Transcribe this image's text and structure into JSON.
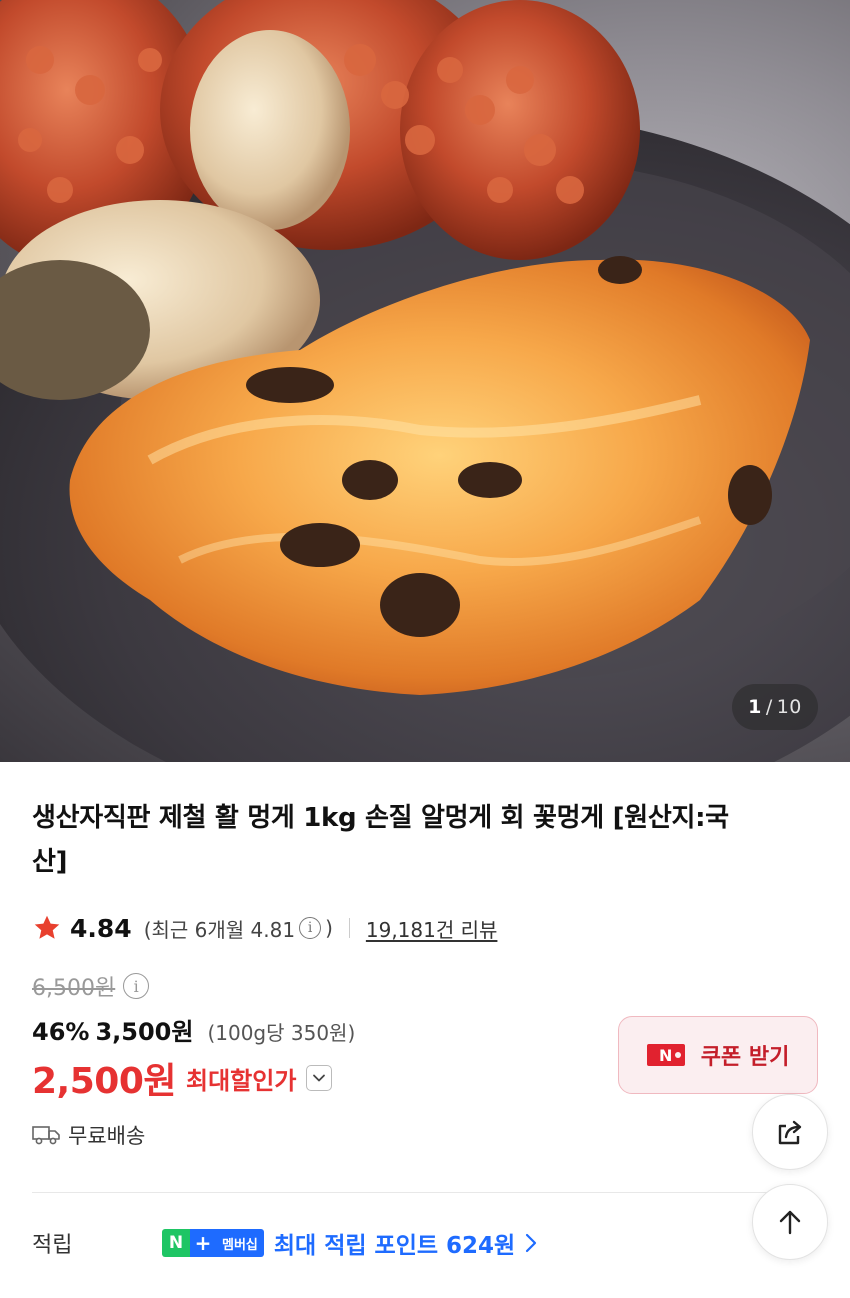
{
  "image": {
    "counter_current": "1",
    "counter_separator": "/",
    "counter_total": "10",
    "description_icon": "product-photo"
  },
  "product": {
    "title": "생산자직판 제철 활 멍게 1kg 손질 알멍게 회 꽃멍게 [원산지:국산]"
  },
  "rating": {
    "score": "4.84",
    "recent_prefix": "(최근 6개월 4.81",
    "recent_info_glyph": "i",
    "recent_suffix": ")",
    "reviews": "19,181건 리뷰"
  },
  "price": {
    "original": "6,500원",
    "original_info_glyph": "i",
    "discount_rate": "46%",
    "sale": "3,500원",
    "unit": "(100g당 350원)",
    "max_discount": "2,500원",
    "max_discount_label": "최대할인가"
  },
  "coupon": {
    "badge": "N",
    "label": "쿠폰 받기"
  },
  "shipping": {
    "label": "무료배송"
  },
  "points": {
    "label": "적립",
    "badge_n": "N",
    "badge_plus": "+",
    "badge_membership": "멤버십",
    "text_prefix": "최대 적립 포인트 ",
    "amount": "624원"
  },
  "colors": {
    "accent_red": "#e63232",
    "naver_blue": "#1e6bff",
    "naver_green": "#1ec564",
    "coupon_bg": "#fbeef0"
  }
}
